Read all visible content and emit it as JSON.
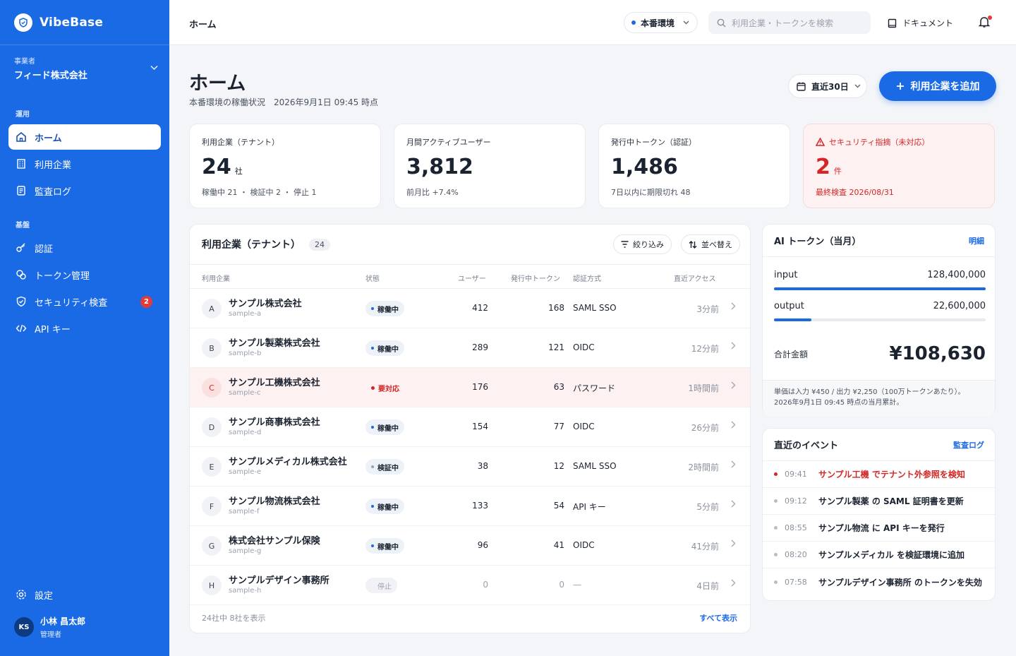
{
  "brand": {
    "name": "VibeBase"
  },
  "org": {
    "label": "事業者",
    "name": "フィード株式会社"
  },
  "sidebar": {
    "section_ops": "運用",
    "section_base": "基盤",
    "items": [
      {
        "label": "ホーム"
      },
      {
        "label": "利用企業"
      },
      {
        "label": "監査ログ"
      },
      {
        "label": "認証"
      },
      {
        "label": "トークン管理"
      },
      {
        "label": "セキュリティ検査",
        "badge": "2"
      },
      {
        "label": "API キー"
      }
    ],
    "settings": "設定"
  },
  "user": {
    "initials": "KS",
    "name": "小林 昌太郎",
    "role": "管理者"
  },
  "header": {
    "title": "ホーム",
    "env": "本番環境",
    "search_placeholder": "利用企業・トークンを検索",
    "docs": "ドキュメント"
  },
  "page": {
    "title": "ホーム",
    "subtitle": "本番環境の稼働状況　2026年9月1日 09:45 時点",
    "range": "直近30日",
    "add_button": "利用企業を追加"
  },
  "stats": [
    {
      "label": "利用企業（テナント）",
      "value": "24",
      "unit": "社",
      "note": "稼働中 21 ・ 検証中 2 ・ 停止 1"
    },
    {
      "label": "月間アクティブユーザー",
      "value": "3,812",
      "unit": "",
      "note": "前月比 +7.4%"
    },
    {
      "label": "発行中トークン（認証）",
      "value": "1,486",
      "unit": "",
      "note": "7日以内に期限切れ 48"
    },
    {
      "label": "セキュリティ指摘（未対応）",
      "value": "2",
      "unit": "件",
      "note": "最終検査 2026/08/31"
    }
  ],
  "tenants": {
    "title": "利用企業（テナント）",
    "count": "24",
    "filter": "絞り込み",
    "sort": "並べ替え",
    "columns": [
      "利用企業",
      "状態",
      "ユーザー",
      "発行中トークン",
      "認証方式",
      "直近アクセス"
    ],
    "rows": [
      {
        "letter": "A",
        "name": "サンプル株式会社",
        "slug": "sample-a",
        "status": "稼働中",
        "users": "412",
        "tokens": "168",
        "auth": "SAML SSO",
        "recent": "3分前"
      },
      {
        "letter": "B",
        "name": "サンプル製薬株式会社",
        "slug": "sample-b",
        "status": "稼働中",
        "users": "289",
        "tokens": "121",
        "auth": "OIDC",
        "recent": "12分前"
      },
      {
        "letter": "C",
        "name": "サンプル工機株式会社",
        "slug": "sample-c",
        "status": "要対応",
        "users": "176",
        "tokens": "63",
        "auth": "パスワード",
        "recent": "1時間前"
      },
      {
        "letter": "D",
        "name": "サンプル商事株式会社",
        "slug": "sample-d",
        "status": "稼働中",
        "users": "154",
        "tokens": "77",
        "auth": "OIDC",
        "recent": "26分前"
      },
      {
        "letter": "E",
        "name": "サンプルメディカル株式会社",
        "slug": "sample-e",
        "status": "検証中",
        "users": "38",
        "tokens": "12",
        "auth": "SAML SSO",
        "recent": "2時間前"
      },
      {
        "letter": "F",
        "name": "サンプル物流株式会社",
        "slug": "sample-f",
        "status": "稼働中",
        "users": "133",
        "tokens": "54",
        "auth": "API キー",
        "recent": "5分前"
      },
      {
        "letter": "G",
        "name": "株式会社サンプル保険",
        "slug": "sample-g",
        "status": "稼働中",
        "users": "96",
        "tokens": "41",
        "auth": "OIDC",
        "recent": "41分前"
      },
      {
        "letter": "H",
        "name": "サンプルデザイン事務所",
        "slug": "sample-h",
        "status": "停止",
        "users": "0",
        "tokens": "0",
        "auth": "—",
        "recent": "4日前"
      }
    ],
    "footer": "24社中 8社を表示",
    "show_all": "すべて表示"
  },
  "ai_tokens": {
    "title": "AI トークン（当月）",
    "link": "明細",
    "input_label": "input",
    "input_value": "128,400,000",
    "input_share": 1.0,
    "output_label": "output",
    "output_value": "22,600,000",
    "output_share": 0.176,
    "total_label": "合計金額",
    "total_value": "¥108,630",
    "note_line1": "単価は入力 ¥450 / 出力 ¥2,250（100万トークンあたり）。",
    "note_line2": "2026年9月1日 09:45 時点の当月累計。"
  },
  "events": {
    "title": "直近のイベント",
    "link": "監査ログ",
    "items": [
      {
        "time": "09:41",
        "text": "サンプル工機 でテナント外参照を検知"
      },
      {
        "time": "09:12",
        "text": "サンプル製薬 の SAML 証明書を更新"
      },
      {
        "time": "08:55",
        "text": "サンプル物流 に API キーを発行"
      },
      {
        "time": "08:20",
        "text": "サンプルメディカル を検証環境に追加"
      },
      {
        "time": "07:58",
        "text": "サンプルデザイン事務所 のトークンを失効"
      }
    ]
  },
  "colors": {
    "brand": "#1a6ae6",
    "danger": "#d32727"
  }
}
